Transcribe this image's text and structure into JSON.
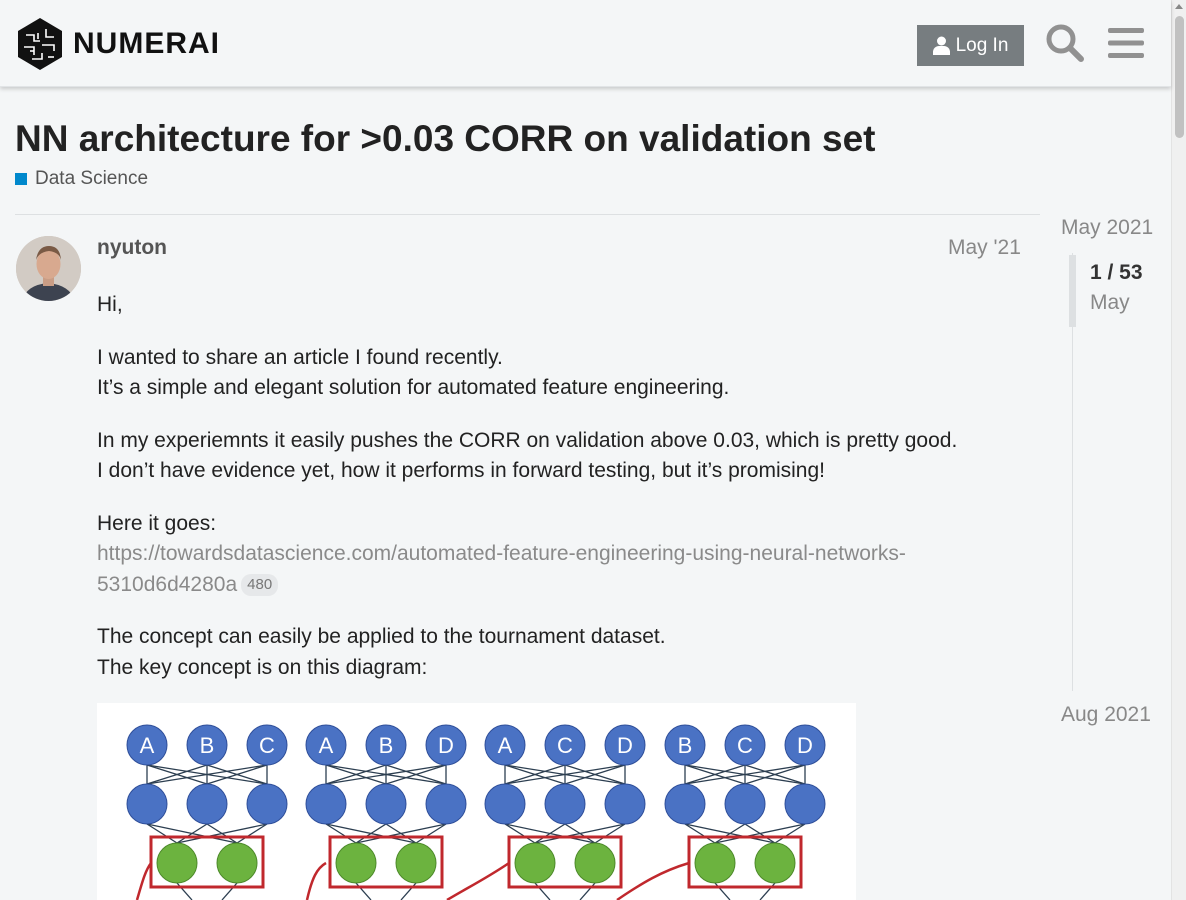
{
  "header": {
    "brand": "NUMERAI",
    "login_label": "Log In"
  },
  "topic": {
    "title": "NN architecture for >0.03 CORR on validation set",
    "category": "Data Science",
    "category_color": "#0088cc"
  },
  "post": {
    "username": "nyuton",
    "date": "May '21",
    "paragraphs": {
      "p1": "Hi,",
      "p2a": "I wanted to share an article I found recently.",
      "p2b": "It’s a simple and elegant solution for automated feature engineering.",
      "p3a": "In my experiemnts it easily pushes the CORR on validation above 0.03, which is pretty good.",
      "p3b": "I don’t have evidence yet, how it performs in forward testing, but it’s promising!",
      "p4": "Here it goes:",
      "link": "https://towardsdatascience.com/automated-feature-engineering-using-neural-networks-5310d6d4280a",
      "link_clicks": "480",
      "p5a": "The concept can easily be applied to the tournament dataset.",
      "p5b": "The key concept is on this diagram:"
    },
    "diagram": {
      "groups": [
        [
          "A",
          "B",
          "C"
        ],
        [
          "A",
          "B",
          "D"
        ],
        [
          "A",
          "C",
          "D"
        ],
        [
          "B",
          "C",
          "D"
        ]
      ],
      "input_color": "#4a72c4",
      "hidden_color": "#4a72c4",
      "output_color": "#6cb33f",
      "box_color": "#c0282d"
    }
  },
  "timeline": {
    "start": "May 2021",
    "position": "1 / 53",
    "current_month": "May",
    "end": "Aug 2021"
  }
}
